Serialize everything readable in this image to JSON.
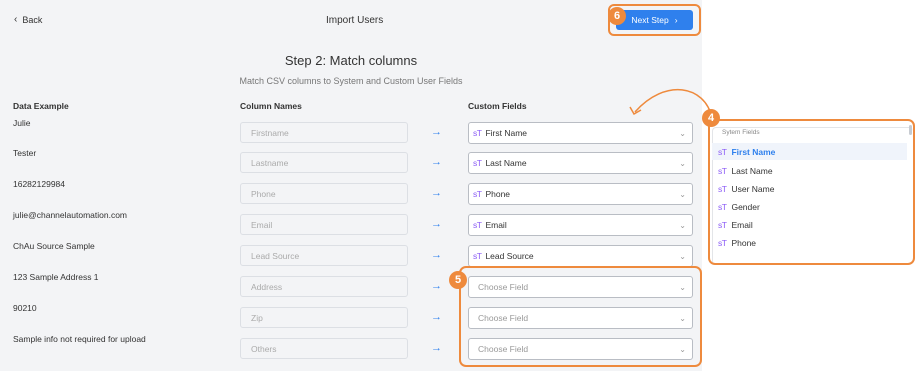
{
  "header": {
    "back_label": "Back",
    "title": "Import Users",
    "next_label": "Next Step"
  },
  "step": {
    "title": "Step 2: Match columns",
    "subtitle": "Match CSV columns to System and Custom User Fields"
  },
  "columns": {
    "data_example": "Data Example",
    "column_names": "Column Names",
    "custom_fields": "Custom Fields"
  },
  "rows": [
    {
      "example": "Julie",
      "column": "Firstname",
      "field": "First Name",
      "mapped": true
    },
    {
      "example": "Tester",
      "column": "Lastname",
      "field": "Last Name",
      "mapped": true
    },
    {
      "example": "16282129984",
      "column": "Phone",
      "field": "Phone",
      "mapped": true
    },
    {
      "example": "julie@channelautomation.com",
      "column": "Email",
      "field": "Email",
      "mapped": true
    },
    {
      "example": "ChAu Source Sample",
      "column": "Lead Source",
      "field": "Lead Source",
      "mapped": true
    },
    {
      "example": "123 Sample Address 1",
      "column": "Address",
      "field": "Choose Field",
      "mapped": false
    },
    {
      "example": "90210",
      "column": "Zip",
      "field": "Choose Field",
      "mapped": false
    },
    {
      "example": "Sample info not required for upload",
      "column": "Others",
      "field": "Choose Field",
      "mapped": false
    }
  ],
  "dropdown": {
    "heading": "Sytem Fields",
    "items": [
      "First Name",
      "Last Name",
      "User Name",
      "Gender",
      "Email",
      "Phone"
    ],
    "selected": "First Name"
  },
  "annotations": {
    "badge_4": "4",
    "badge_5": "5",
    "badge_6": "6"
  },
  "icons": {
    "field_type_icon": "sT",
    "arrow_icon": "→",
    "caret_icon": "⌄"
  },
  "colors": {
    "accent": "#2f80ed",
    "highlight": "#ee8a3d",
    "field_icon": "#8b5cf6"
  }
}
